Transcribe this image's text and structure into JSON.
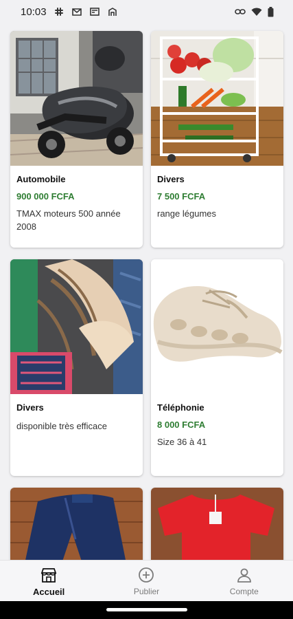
{
  "status": {
    "time": "10:03"
  },
  "listings": [
    {
      "category": "Automobile",
      "price": "900 000 FCFA",
      "description": "TMAX moteurs 500 année 2008"
    },
    {
      "category": "Divers",
      "price": "7 500 FCFA",
      "description": "range légumes"
    },
    {
      "category": "Divers",
      "price": "",
      "description": "disponible très efficace"
    },
    {
      "category": "Téléphonie",
      "price": "8 000 FCFA",
      "description": "Size 36 à 41"
    }
  ],
  "nav": {
    "home": "Accueil",
    "publish": "Publier",
    "account": "Compte"
  },
  "colors": {
    "price": "#2e7d32",
    "background": "#f1f1f3"
  }
}
